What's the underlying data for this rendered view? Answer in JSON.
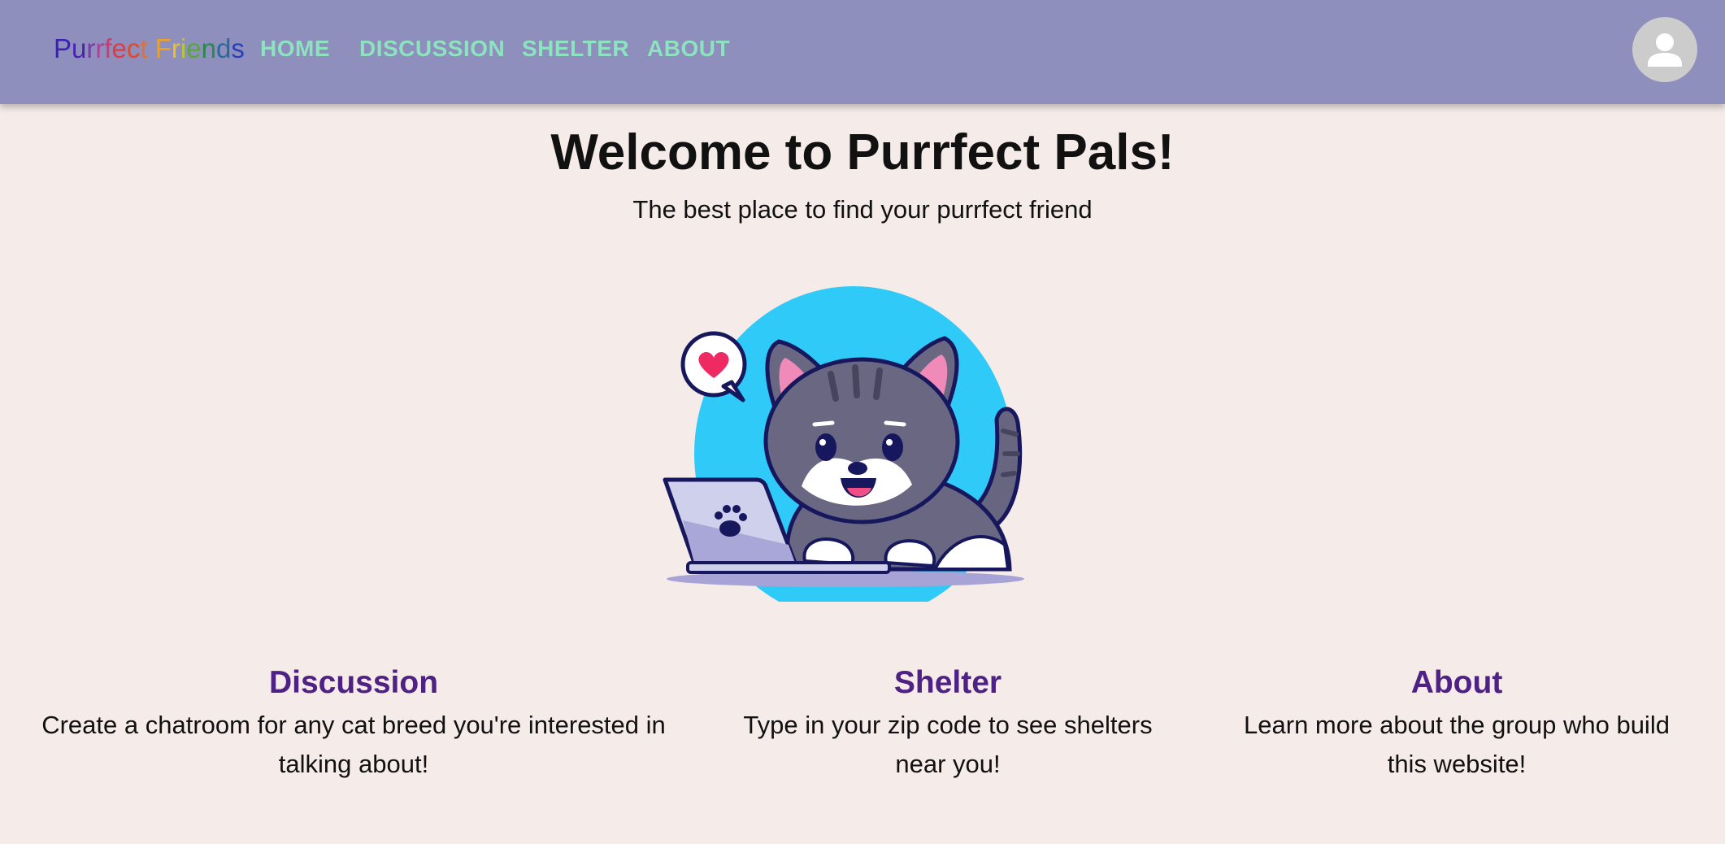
{
  "appbar": {
    "brand": {
      "letters": [
        "P",
        "u",
        "r",
        "r",
        "f",
        "e",
        "c",
        "t",
        " ",
        "F",
        "r",
        "i",
        "e",
        "n",
        "d",
        "s"
      ],
      "colors": [
        "#3a1fb8",
        "#4a22b0",
        "#7a3aa8",
        "#b0409a",
        "#d23a6a",
        "#e03a45",
        "#e04a2a",
        "#e8702a",
        "#ffffff",
        "#f0a020",
        "#e8c030",
        "#b8c838",
        "#58a838",
        "#2a8850",
        "#2a6a98",
        "#2840b8"
      ]
    },
    "nav": {
      "home": "HOME",
      "discussion": "DISCUSSION",
      "shelter": "SHELTER",
      "about": "ABOUT"
    },
    "nav_color": "#8de2bf",
    "background": "#8e8fbd"
  },
  "hero": {
    "title": "Welcome to Purrfect Pals!",
    "subtitle": "The best place to find your purrfect friend",
    "illustration": "cat-with-laptop-illustration"
  },
  "cards": [
    {
      "title": "Discussion",
      "text": "Create a chatroom for any cat breed you're interested in talking about!"
    },
    {
      "title": "Shelter",
      "text": "Type in your zip code to see shelters near you!"
    },
    {
      "title": "About",
      "text": "Learn more about the group who build this website!"
    }
  ],
  "colors": {
    "page_background": "#f5ebe8",
    "card_title": "#4e2184"
  }
}
